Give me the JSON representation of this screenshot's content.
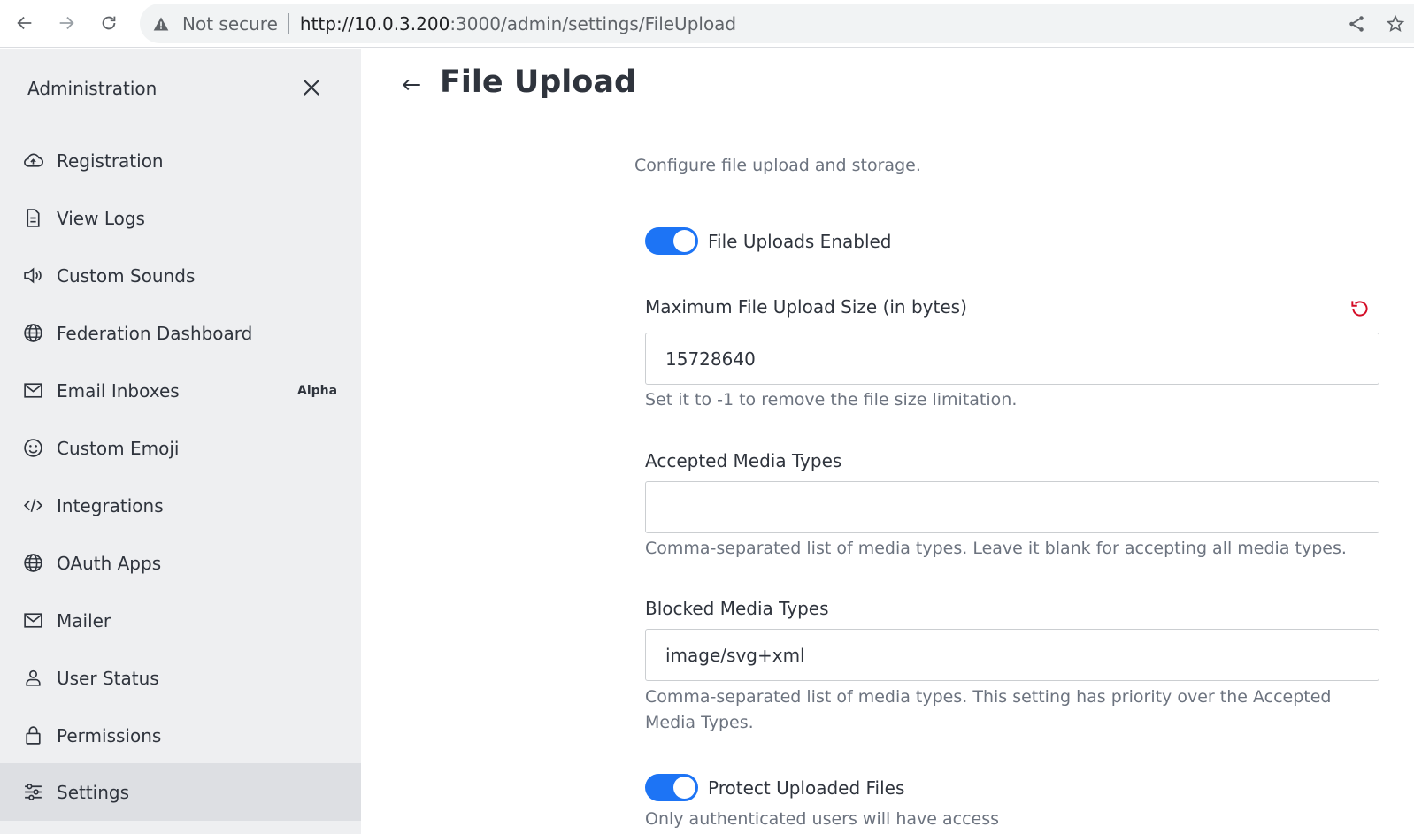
{
  "browser": {
    "not_secure": "Not secure",
    "url_host": "http://10.0.3.200",
    "url_rest": ":3000/admin/settings/FileUpload"
  },
  "sidebar": {
    "title": "Administration",
    "items": [
      {
        "label": "Registration",
        "icon": "cloud-icon"
      },
      {
        "label": "View Logs",
        "icon": "document-icon"
      },
      {
        "label": "Custom Sounds",
        "icon": "speaker-icon"
      },
      {
        "label": "Federation Dashboard",
        "icon": "globe-icon"
      },
      {
        "label": "Email Inboxes",
        "icon": "mail-icon",
        "badge": "Alpha"
      },
      {
        "label": "Custom Emoji",
        "icon": "emoji-icon"
      },
      {
        "label": "Integrations",
        "icon": "code-icon"
      },
      {
        "label": "OAuth Apps",
        "icon": "globe-icon"
      },
      {
        "label": "Mailer",
        "icon": "mail-icon"
      },
      {
        "label": "User Status",
        "icon": "user-icon"
      },
      {
        "label": "Permissions",
        "icon": "lock-icon"
      },
      {
        "label": "Settings",
        "icon": "sliders-icon",
        "active": true
      }
    ]
  },
  "main": {
    "title": "File Upload",
    "description": "Configure file upload and storage.",
    "file_uploads_enabled": {
      "label": "File Uploads Enabled",
      "on": true
    },
    "max_size": {
      "label": "Maximum File Upload Size (in bytes)",
      "value": "15728640",
      "hint": "Set it to -1 to remove the file size limitation."
    },
    "accepted_types": {
      "label": "Accepted Media Types",
      "value": "",
      "hint": "Comma-separated list of media types. Leave it blank for accepting all media types."
    },
    "blocked_types": {
      "label": "Blocked Media Types",
      "value": "image/svg+xml",
      "hint": "Comma-separated list of media types. This setting has priority over the Accepted Media Types."
    },
    "protect_files": {
      "label": "Protect Uploaded Files",
      "on": true,
      "hint": "Only authenticated users will have access"
    }
  },
  "colors": {
    "accent": "#1d74f5",
    "reset": "#d40c26",
    "sidebar_bg": "#eeeff1",
    "sidebar_active": "#dddfe3"
  }
}
